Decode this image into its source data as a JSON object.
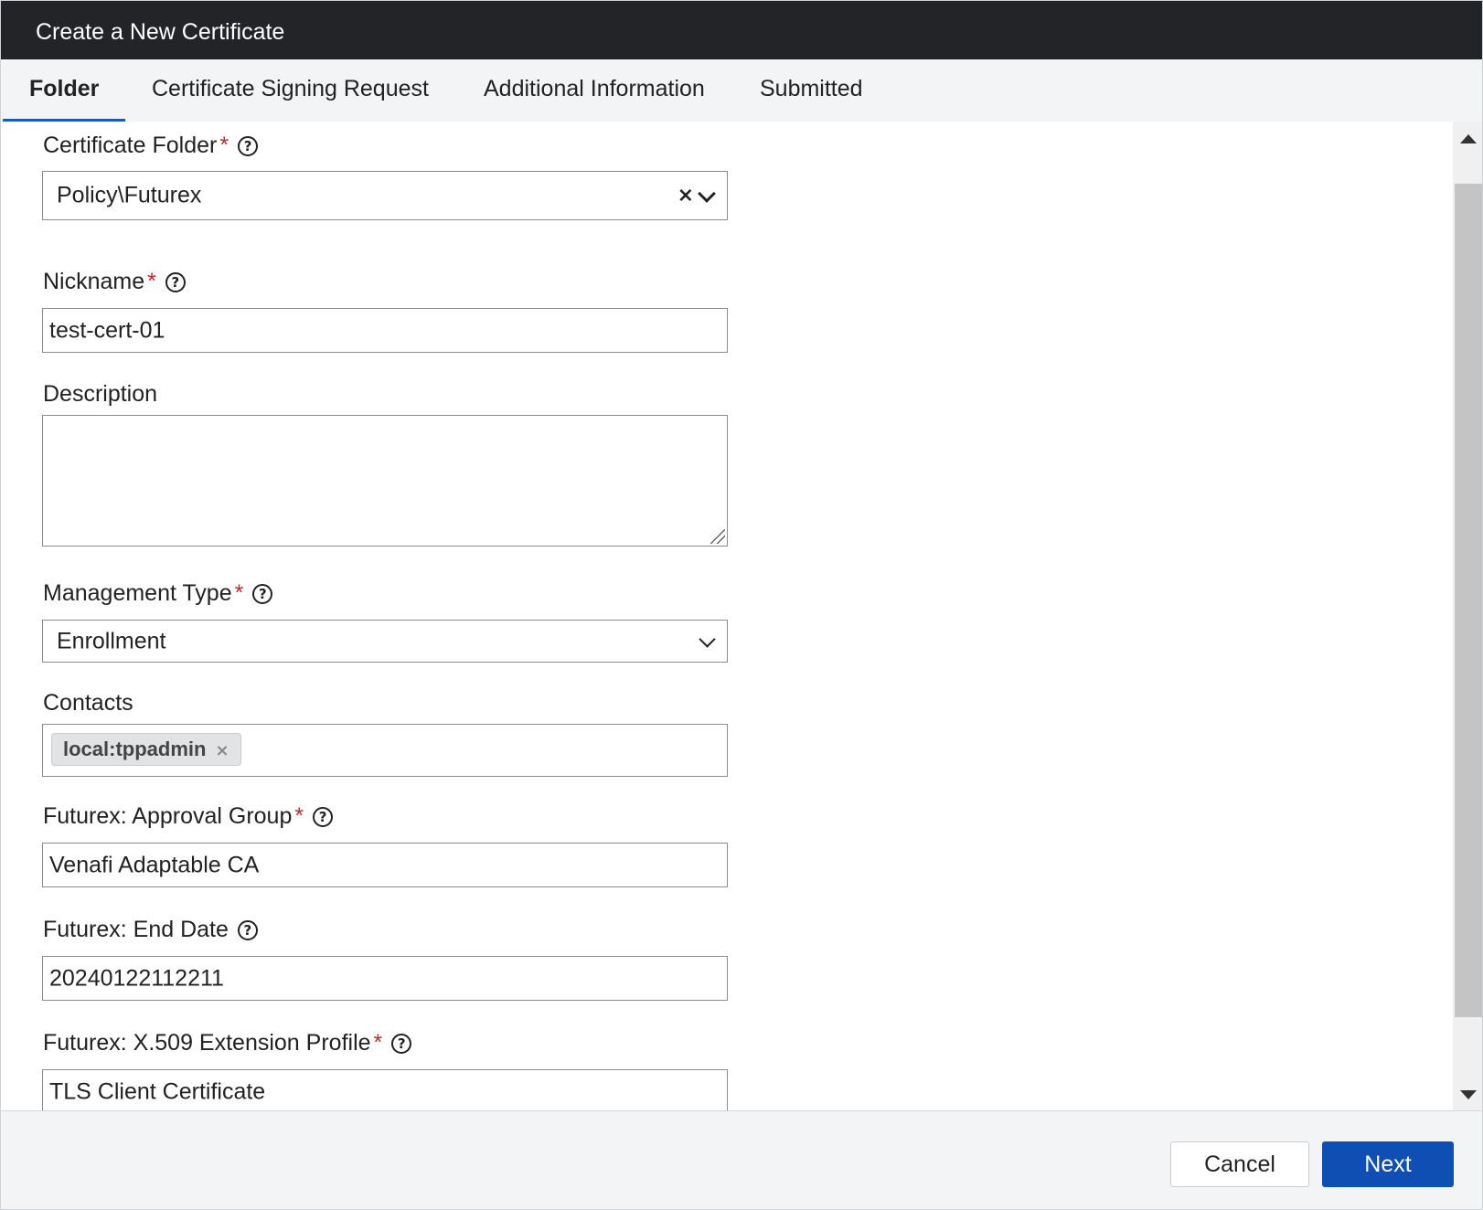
{
  "window": {
    "title": "Create a New Certificate"
  },
  "tabs": [
    {
      "label": "Folder",
      "active": true
    },
    {
      "label": "Certificate Signing Request",
      "active": false
    },
    {
      "label": "Additional Information",
      "active": false
    },
    {
      "label": "Submitted",
      "active": false
    }
  ],
  "form": {
    "required_marker": "*",
    "help_glyph": "?",
    "certificate_folder": {
      "label": "Certificate Folder",
      "value": "Policy\\Futurex",
      "clear_glyph": "×"
    },
    "nickname": {
      "label": "Nickname",
      "value": "test-cert-01"
    },
    "description": {
      "label": "Description",
      "value": ""
    },
    "management_type": {
      "label": "Management Type",
      "value": "Enrollment"
    },
    "contacts": {
      "label": "Contacts",
      "chips": [
        {
          "label": "local:tppadmin",
          "remove_glyph": "×"
        }
      ]
    },
    "approval_group": {
      "label": "Futurex: Approval Group",
      "value": "Venafi Adaptable CA"
    },
    "end_date": {
      "label": "Futurex: End Date",
      "value": "20240122112211"
    },
    "extension_profile": {
      "label": "Futurex: X.509 Extension Profile",
      "value": "TLS Client Certificate"
    }
  },
  "footer": {
    "cancel_label": "Cancel",
    "next_label": "Next"
  },
  "colors": {
    "titlebar": "#222427",
    "accent": "#0f4fb3",
    "required": "#c62828"
  }
}
